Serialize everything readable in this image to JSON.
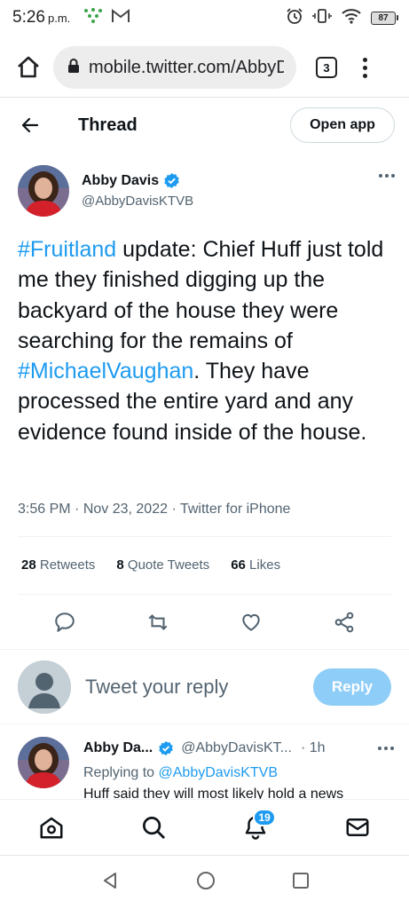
{
  "status_bar": {
    "time": "5:26",
    "ampm": "p.m.",
    "battery": "87"
  },
  "browser": {
    "url": "mobile.twitter.com/AbbyDavisKTVB/status",
    "tab_count": "3"
  },
  "header": {
    "title": "Thread",
    "open_app_label": "Open app"
  },
  "tweet": {
    "author_name": "Abby Davis",
    "author_handle": "@AbbyDavisKTVB",
    "text_parts": {
      "hashtag1": "#Fruitland",
      "segment1": " update: Chief Huff just told me they finished digging up the backyard of the house they were searching for the remains of ",
      "hashtag2": "#MichaelVaughan",
      "segment2": ". They have processed the entire yard and any evidence found inside of the house."
    },
    "time": "3:56 PM",
    "date": "Nov 23, 2022",
    "source": "Twitter for iPhone",
    "retweets_count": "28",
    "retweets_label": "Retweets",
    "quotes_count": "8",
    "quotes_label": "Quote Tweets",
    "likes_count": "66",
    "likes_label": "Likes"
  },
  "composer": {
    "placeholder": "Tweet your reply",
    "reply_label": "Reply"
  },
  "reply": {
    "author_name": "Abby Da...",
    "author_handle": "@AbbyDavisKT...",
    "time": "1h",
    "replying_prefix": "Replying to ",
    "replying_to": "@AbbyDavisKTVB",
    "text": "Huff said they will most likely hold a news"
  },
  "bottom_nav": {
    "notifications_badge": "19"
  },
  "colors": {
    "accent": "#1d9bf0",
    "reply_button": "#8ecdf8",
    "muted_text": "#536471"
  }
}
